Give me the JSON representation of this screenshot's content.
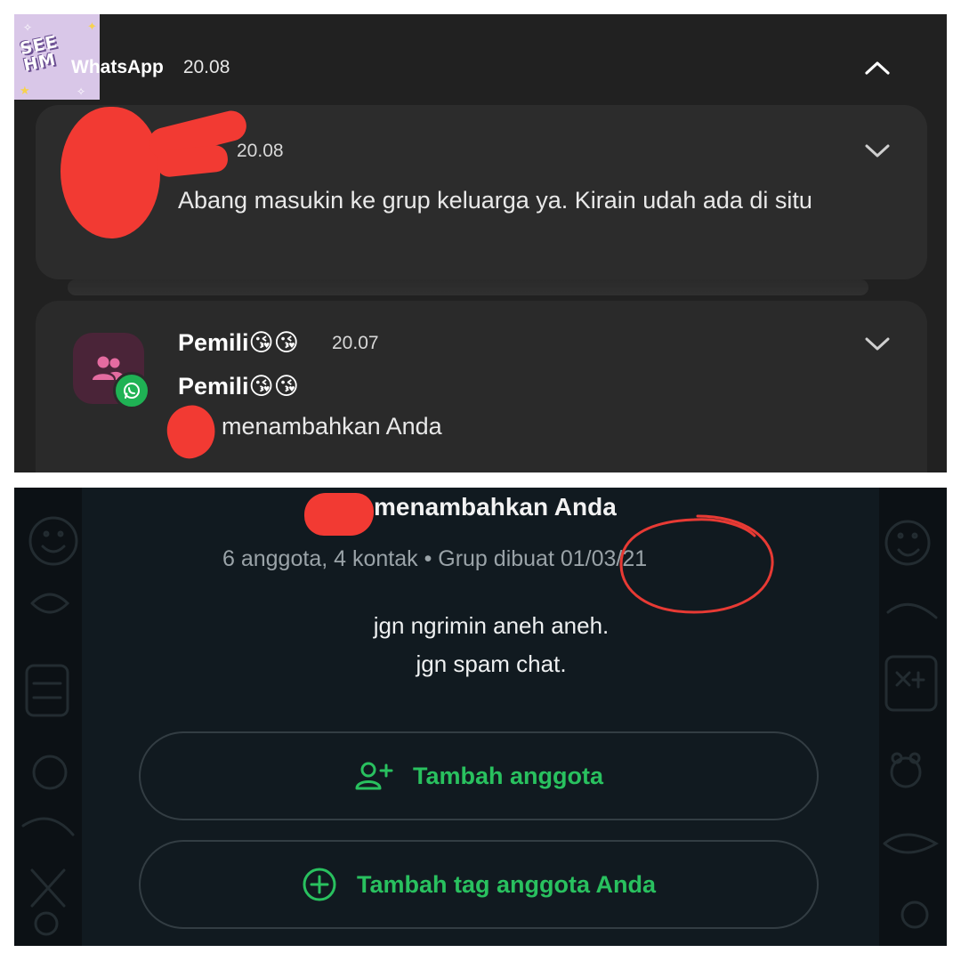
{
  "notification": {
    "app_name": "WhatsApp",
    "app_time": "20.08",
    "items": [
      {
        "time": "20.08",
        "message": "Abang masukin ke grup keluarga ya. Kirain udah ada di situ"
      },
      {
        "title": "Pemili",
        "title_emoji": "😘😘",
        "time": "20.07",
        "subtitle": "Pemili",
        "subtitle_emoji": "😘😘",
        "message": "menambahkan Anda"
      }
    ],
    "icons": {
      "collapse": "chevron-up-icon",
      "expand": "chevron-down-icon",
      "avatar": "group-icon",
      "badge": "whatsapp-icon"
    }
  },
  "group_info": {
    "added_text": "menambahkan Anda",
    "meta": "6 anggota, 4 kontak • Grup dibuat 01/03/21",
    "description_lines": [
      "jgn ngrimin aneh aneh.",
      "jgn spam chat."
    ],
    "buttons": [
      {
        "label": "Tambah anggota",
        "icon": "person-add-icon"
      },
      {
        "label": "Tambah tag anggota Anda",
        "icon": "plus-circle-icon"
      }
    ]
  },
  "colors": {
    "accent_green": "#29c15f",
    "redaction": "#f23a33",
    "annotation_circle": "#e83a34"
  }
}
